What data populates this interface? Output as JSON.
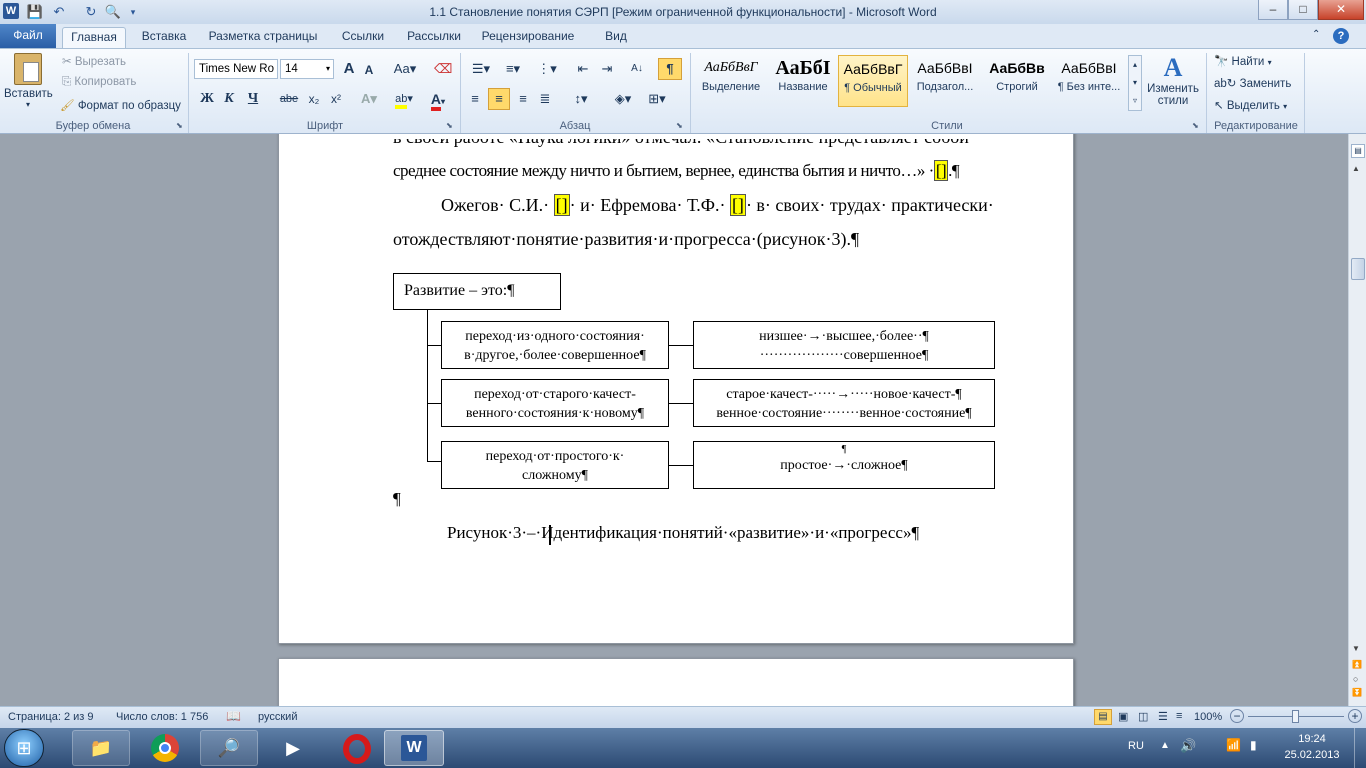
{
  "window": {
    "title": "1.1 Становление понятия СЭРП [Режим ограниченной функциональности]  -  Microsoft Word",
    "min": "–",
    "max": "□",
    "close": "✕"
  },
  "tabs": {
    "file": "Файл",
    "items": [
      "Главная",
      "Вставка",
      "Разметка страницы",
      "Ссылки",
      "Рассылки",
      "Рецензирование",
      "Вид"
    ]
  },
  "ribbon": {
    "clipboard": {
      "paste": "Вставить",
      "cut": "Вырезать",
      "copy": "Копировать",
      "format_painter": "Формат по образцу",
      "label": "Буфер обмена"
    },
    "font": {
      "name": "Times New Ro",
      "size": "14",
      "bold": "Ж",
      "italic": "К",
      "underline": "Ч",
      "strike": "abe",
      "sub": "x₂",
      "sup": "x²",
      "grow": "A",
      "shrink": "A",
      "case": "Aa",
      "label": "Шрифт",
      "color_letter": "A",
      "highlight_letter": "ab"
    },
    "paragraph": {
      "label": "Абзац",
      "pilcrow": "¶"
    },
    "styles": {
      "label": "Стили",
      "items": [
        {
          "preview": "АаБбВвГ",
          "name": "Выделение"
        },
        {
          "preview": "АаБбІ",
          "name": "Название"
        },
        {
          "preview": "АаБбВвГ",
          "name": "¶ Обычный"
        },
        {
          "preview": "АаБбВвІ",
          "name": "Подзагол..."
        },
        {
          "preview": "АаБбВв",
          "name": "Строгий"
        },
        {
          "preview": "АаБбВвІ",
          "name": "¶ Без инте..."
        }
      ],
      "change": "Изменить стили"
    },
    "editing": {
      "find": "Найти",
      "replace": "Заменить",
      "select": "Выделить",
      "label": "Редактирование"
    }
  },
  "document": {
    "line0": "в своей работе «Наука логики» отмечал: «Становление представляет собой",
    "line1": "среднее состояние между ничто и бытием, вернее, единства бытия и ничто…» ·",
    "line1_cite": "[]",
    "line1_end": ".¶",
    "line2_a": "Ожегов· С.И.·",
    "line2_c1": "[]",
    "line2_b": "· и· Ефремова· Т.Ф.·",
    "line2_c2": "[]",
    "line2_c": "· в· своих· трудах· практически·",
    "line3": "отождествляют·понятие·развития·и·прогресса·(рисунок·3).¶",
    "diagram": {
      "root": "Развитие – это:¶",
      "left": [
        [
          "переход·из·одного·состояния·",
          "в·другое,·более·совершенное¶"
        ],
        [
          "переход·от·старого·качест-",
          "венного·состояния·к·новому¶"
        ],
        [
          "переход·от·простого·к·",
          "сложному¶"
        ]
      ],
      "right": [
        [
          "низшее·→·высшее,·более··¶",
          "··················совершенное¶"
        ],
        [
          "старое·качест-·····→·····новое·качест-¶",
          "венное·состояние········венное·состояние¶"
        ],
        [
          "¶",
          "простое·→·сложное¶"
        ]
      ]
    },
    "empty_para": "¶",
    "caption": "Рисунок·3·–·Идентификация·понятий·«развитие»·и·«прогресс»¶"
  },
  "status": {
    "page": "Страница: 2 из 9",
    "words": "Число слов: 1 756",
    "lang": "русский",
    "zoom": "100%"
  },
  "taskbar": {
    "lang": "RU",
    "time": "19:24",
    "date": "25.02.2013"
  }
}
